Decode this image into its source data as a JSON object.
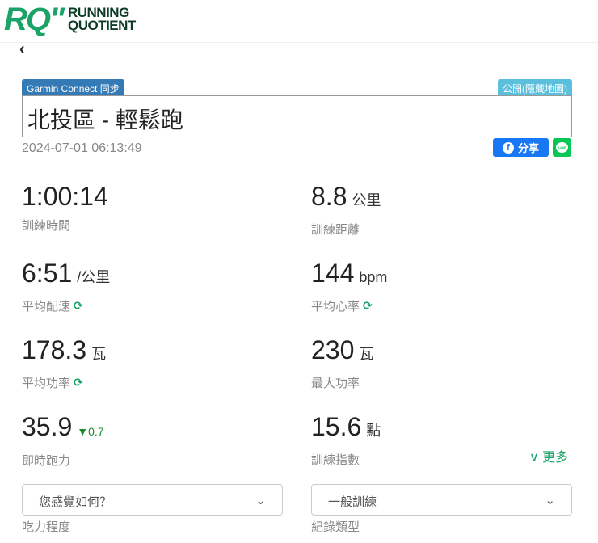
{
  "header": {
    "logo_mark": "RQ\"",
    "logo_line1": "RUNNING",
    "logo_line2": "QUOTIENT"
  },
  "back_icon": "‹",
  "badges": {
    "sync": "Garmin Connect 同步",
    "visibility": "公開(隱藏地圖)"
  },
  "activity": {
    "title": "北投區 - 輕鬆跑",
    "datetime": "2024-07-01 06:13:49"
  },
  "share": {
    "facebook_label": "分享",
    "line_label": "LINE"
  },
  "metrics": [
    {
      "value": "1:00:14",
      "unit": "",
      "label": "訓練時間"
    },
    {
      "value": "8.8",
      "unit": "公里",
      "label": "訓練距離"
    },
    {
      "value": "6:51",
      "unit": "/公里",
      "label": "平均配速"
    },
    {
      "value": "144",
      "unit": "bpm",
      "label": "平均心率"
    },
    {
      "value": "178.3",
      "unit": "瓦",
      "label": "平均功率"
    },
    {
      "value": "230",
      "unit": "瓦",
      "label": "最大功率"
    },
    {
      "value": "35.9",
      "unit": "",
      "label": "即時跑力",
      "delta": "▼0.7"
    },
    {
      "value": "15.6",
      "unit": "點",
      "label": "訓練指數"
    }
  ],
  "sync_icon": "⟳",
  "more_label": "更多",
  "more_icon": "∨",
  "selects": [
    {
      "value": "您感覺如何？",
      "label": "吃力程度"
    },
    {
      "value": "一般訓練",
      "label": "紀錄類型"
    }
  ],
  "chevron": "⌄"
}
